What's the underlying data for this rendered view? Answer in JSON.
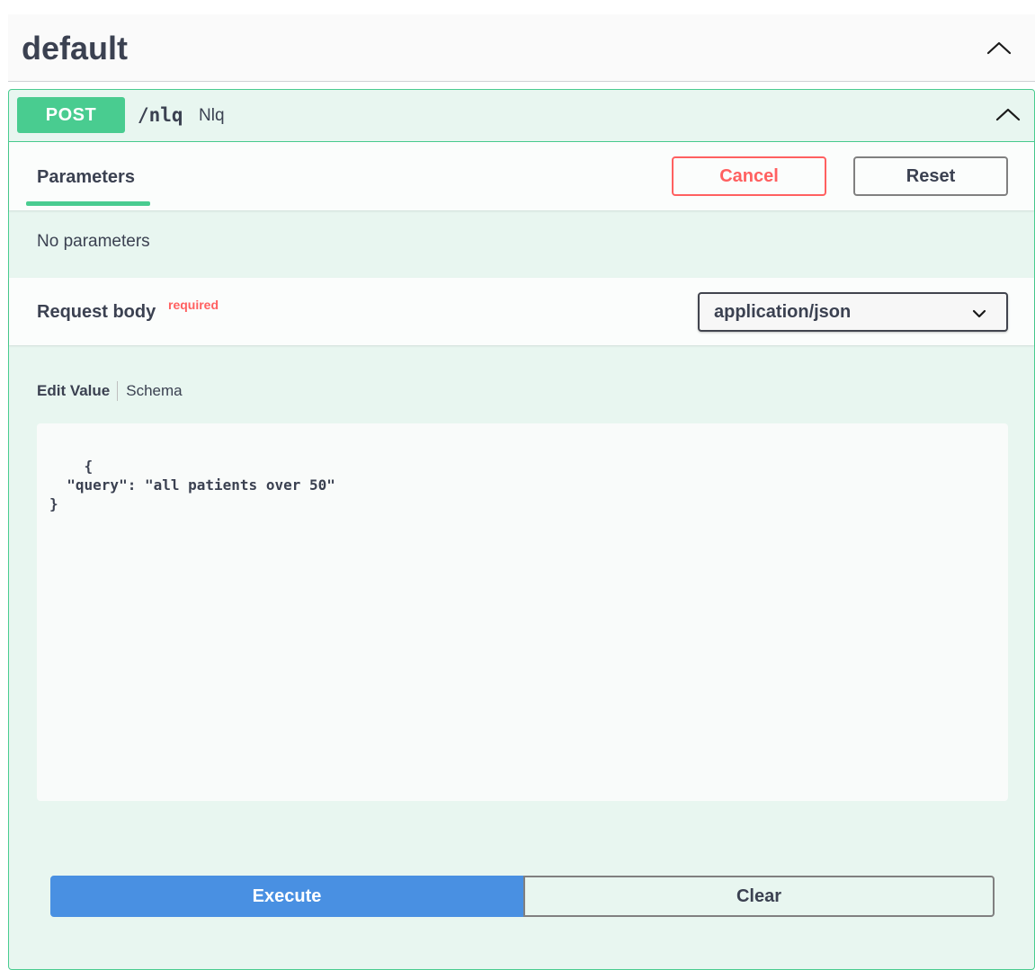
{
  "section": {
    "title": "default",
    "toggle_icon": "chevron-up-icon"
  },
  "operation": {
    "method": "POST",
    "path": "/nlq",
    "summary": "Nlq",
    "toggle_icon": "chevron-up-icon",
    "colors": {
      "method_badge": "#49cc90",
      "block_background": "#e8f6f0",
      "block_border": "#49cc90"
    }
  },
  "parameters": {
    "tab_label": "Parameters",
    "cancel_label": "Cancel",
    "reset_label": "Reset",
    "empty_text": "No parameters"
  },
  "request_body": {
    "title": "Request body",
    "required_label": "required",
    "content_type": "application/json",
    "content_type_options": [
      "application/json"
    ],
    "select_icon": "chevron-down-icon",
    "edit_tabs": {
      "edit_value": "Edit Value",
      "schema": "Schema"
    },
    "body_value": "{\n  \"query\": \"all patients over 50\"\n}"
  },
  "actions": {
    "execute_label": "Execute",
    "clear_label": "Clear",
    "execute_color": "#4990e2"
  }
}
